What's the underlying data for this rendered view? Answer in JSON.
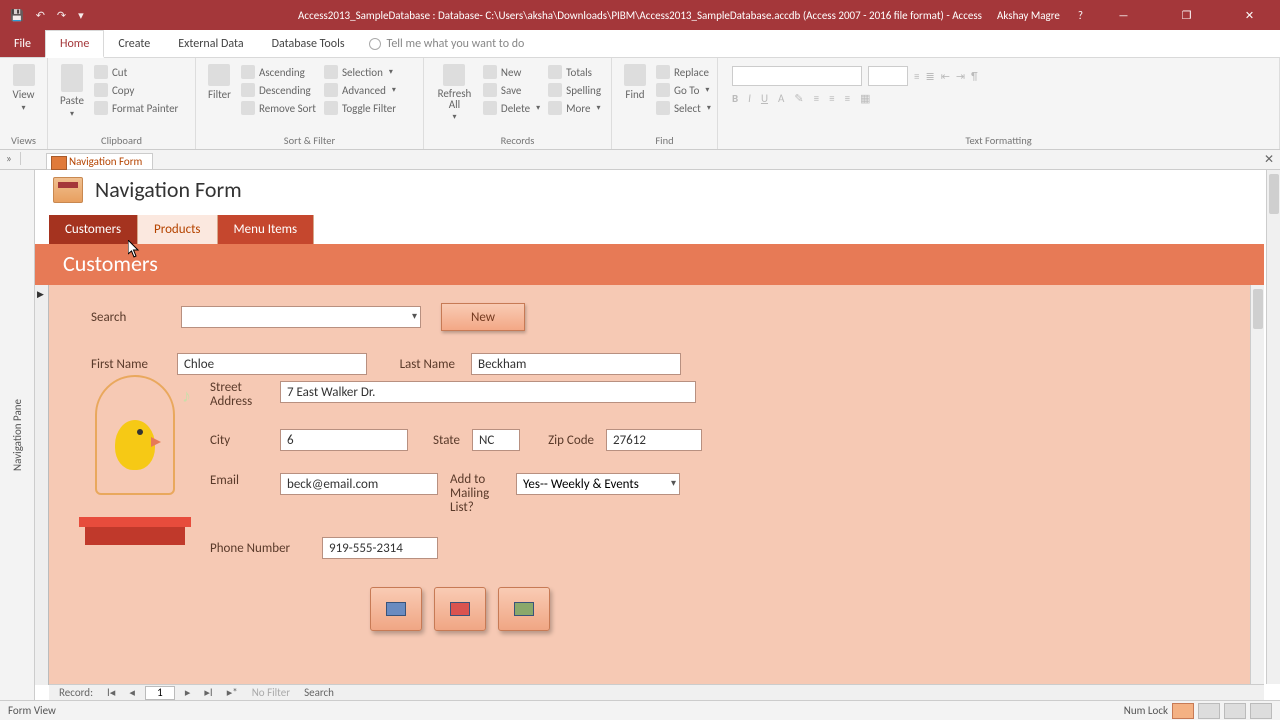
{
  "titlebar": {
    "title": "Access2013_SampleDatabase : Database- C:\\Users\\aksha\\Downloads\\PIBM\\Access2013_SampleDatabase.accdb (Access 2007 - 2016 file format) -  Access",
    "user": "Akshay Magre"
  },
  "ribbon_tabs": {
    "file": "File",
    "home": "Home",
    "create": "Create",
    "external": "External Data",
    "dbtools": "Database Tools",
    "tellme": "Tell me what you want to do"
  },
  "ribbon": {
    "views": {
      "view": "View",
      "group": "Views"
    },
    "clipboard": {
      "paste": "Paste",
      "cut": "Cut",
      "copy": "Copy",
      "painter": "Format Painter",
      "group": "Clipboard"
    },
    "sortfilter": {
      "filter": "Filter",
      "asc": "Ascending",
      "desc": "Descending",
      "remove": "Remove Sort",
      "selection": "Selection",
      "advanced": "Advanced",
      "toggle": "Toggle Filter",
      "group": "Sort & Filter"
    },
    "records": {
      "refresh": "Refresh All",
      "new": "New",
      "save": "Save",
      "delete": "Delete",
      "totals": "Totals",
      "spelling": "Spelling",
      "more": "More",
      "group": "Records"
    },
    "find": {
      "find": "Find",
      "replace": "Replace",
      "goto": "Go To",
      "select": "Select",
      "group": "Find"
    },
    "textfmt": {
      "group": "Text Formatting"
    }
  },
  "doc_tab": "Navigation Form",
  "navpane_label": "Navigation Pane",
  "navform": {
    "title": "Navigation Form",
    "tabs": {
      "customers": "Customers",
      "products": "Products",
      "menu": "Menu Items"
    },
    "subhead": "Customers",
    "labels": {
      "search": "Search",
      "first": "First Name",
      "last": "Last Name",
      "street": "Street Address",
      "city": "City",
      "state": "State",
      "zip": "Zip Code",
      "email": "Email",
      "mailing": "Add to Mailing List?",
      "phone": "Phone Number"
    },
    "values": {
      "first": "Chloe",
      "last": "Beckham",
      "street": "7 East Walker Dr.",
      "city": "6",
      "state": "NC",
      "zip": "27612",
      "email": "beck@email.com",
      "mailing": "Yes-- Weekly & Events",
      "phone": "919-555-2314"
    },
    "newrec": "New",
    "recnav": {
      "label": "Record:",
      "pos": "1",
      "filter": "No Filter",
      "search": "Search"
    }
  },
  "statusbar": {
    "left": "Form View",
    "numlock": "Num Lock"
  }
}
